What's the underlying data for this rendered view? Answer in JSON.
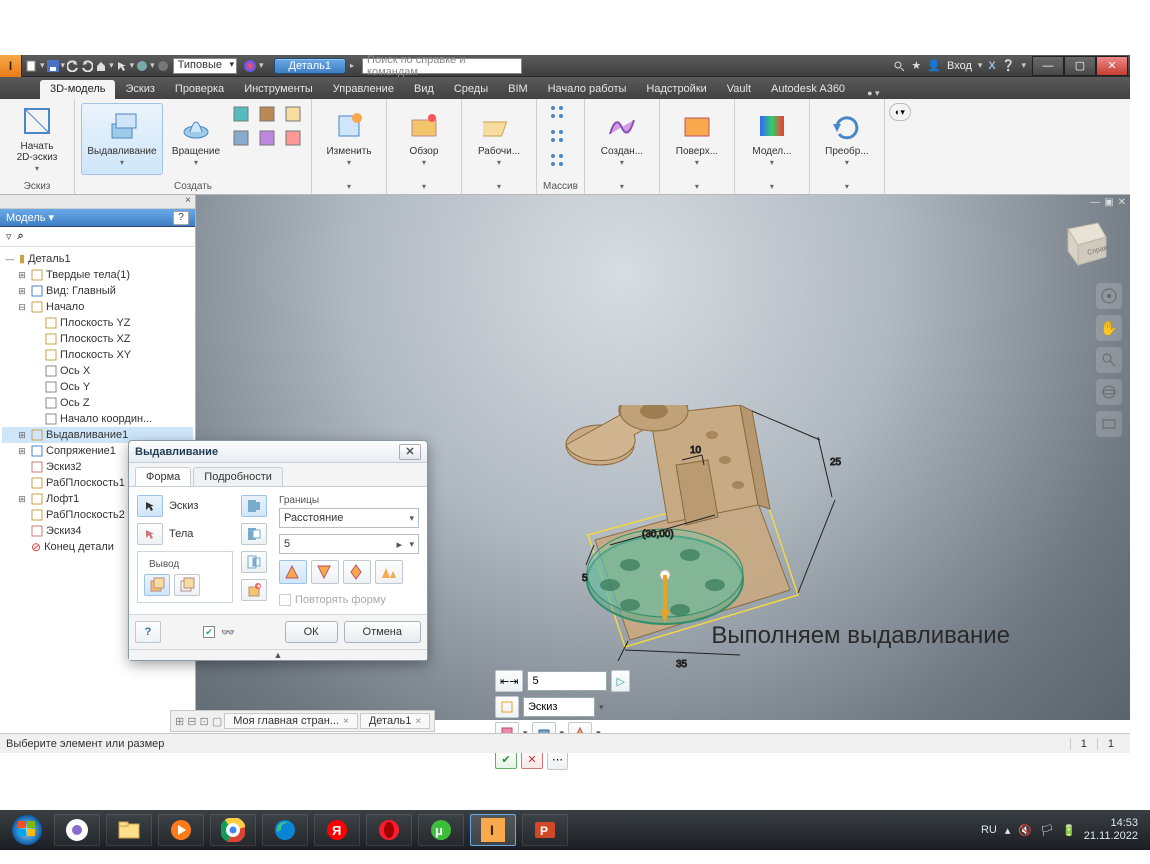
{
  "titlebar": {
    "combo": "Типовые",
    "doc_tab": "Деталь1",
    "search_placeholder": "Поиск по справке и командам",
    "signin": "Вход"
  },
  "tabs": [
    "3D-модель",
    "Эскиз",
    "Проверка",
    "Инструменты",
    "Управление",
    "Вид",
    "Среды",
    "BIM",
    "Начало работы",
    "Надстройки",
    "Vault",
    "Autodesk A360"
  ],
  "active_tab": 0,
  "ribbon": {
    "groups": [
      {
        "title": "Эскиз",
        "big": [
          {
            "label": "Начать\n2D-эскиз",
            "icon": "sketch"
          }
        ]
      },
      {
        "title": "Создать",
        "big": [
          {
            "label": "Выдавливание",
            "icon": "extrude",
            "sel": true
          },
          {
            "label": "Вращение",
            "icon": "revolve"
          }
        ],
        "mini": true
      },
      {
        "title": "",
        "big": [
          {
            "label": "Изменить",
            "icon": "modify"
          }
        ]
      },
      {
        "title": "",
        "big": [
          {
            "label": "Обзор",
            "icon": "explore"
          }
        ]
      },
      {
        "title": "",
        "big": [
          {
            "label": "Рабочи...",
            "icon": "workplane"
          }
        ]
      },
      {
        "title": "Массив",
        "mini2": true
      },
      {
        "title": "",
        "big": [
          {
            "label": "Создан...",
            "icon": "freeform"
          }
        ]
      },
      {
        "title": "",
        "big": [
          {
            "label": "Поверх...",
            "icon": "surface"
          }
        ]
      },
      {
        "title": "",
        "big": [
          {
            "label": "Модел...",
            "icon": "simulate"
          }
        ]
      },
      {
        "title": "",
        "big": [
          {
            "label": "Преобр...",
            "icon": "convert"
          }
        ]
      }
    ]
  },
  "browser": {
    "title": "Модель",
    "root": "Деталь1",
    "items": [
      {
        "lvl": 1,
        "exp": "+",
        "ico": "solids",
        "label": "Твердые тела(1)"
      },
      {
        "lvl": 1,
        "exp": "+",
        "ico": "view",
        "label": "Вид: Главный"
      },
      {
        "lvl": 1,
        "exp": "-",
        "ico": "origin",
        "label": "Начало"
      },
      {
        "lvl": 2,
        "ico": "plane",
        "label": "Плоскость YZ"
      },
      {
        "lvl": 2,
        "ico": "plane",
        "label": "Плоскость XZ"
      },
      {
        "lvl": 2,
        "ico": "plane",
        "label": "Плоскость XY"
      },
      {
        "lvl": 2,
        "ico": "axis",
        "label": "Ось X"
      },
      {
        "lvl": 2,
        "ico": "axis",
        "label": "Ось Y"
      },
      {
        "lvl": 2,
        "ico": "axis",
        "label": "Ось Z"
      },
      {
        "lvl": 2,
        "ico": "point",
        "label": "Начало координ..."
      },
      {
        "lvl": 1,
        "exp": "+",
        "ico": "extrude",
        "label": "Выдавливание1",
        "sel": true
      },
      {
        "lvl": 1,
        "exp": "+",
        "ico": "fillet",
        "label": "Сопряжение1"
      },
      {
        "lvl": 1,
        "ico": "sketch",
        "label": "Эскиз2"
      },
      {
        "lvl": 1,
        "ico": "workplane",
        "label": "РабПлоскость1"
      },
      {
        "lvl": 1,
        "exp": "+",
        "ico": "loft",
        "label": "Лофт1"
      },
      {
        "lvl": 1,
        "ico": "workplane",
        "label": "РабПлоскость2"
      },
      {
        "lvl": 1,
        "ico": "sketch",
        "label": "Эскиз4"
      },
      {
        "lvl": 1,
        "ico": "end",
        "label": "Конец детали"
      }
    ]
  },
  "dialog": {
    "title": "Выдавливание",
    "tabs": [
      "Форма",
      "Подробности"
    ],
    "active_tab": 0,
    "profiles_label": "Эскиз",
    "solids_label": "Тела",
    "output_label": "Вывод",
    "extents_label": "Границы",
    "extents_mode": "Расстояние",
    "distance": "5",
    "match_shape": "Повторять форму",
    "ok": "ОК",
    "cancel": "Отмена"
  },
  "mini": {
    "distance": "5",
    "profile_sel": "Эскиз"
  },
  "dims": {
    "d1": "10",
    "d2": "25",
    "d3": "5",
    "d4": "35",
    "d5": "(30,00)"
  },
  "caption": "Выполняем выдавливание",
  "doc_tabs": [
    "Моя главная стран...",
    "Деталь1"
  ],
  "status": {
    "prompt": "Выберите элемент или размер",
    "c1": "1",
    "c2": "1"
  },
  "tray": {
    "lang": "RU",
    "time": "14:53",
    "date": "21.11.2022"
  },
  "viewcube": "Справа"
}
